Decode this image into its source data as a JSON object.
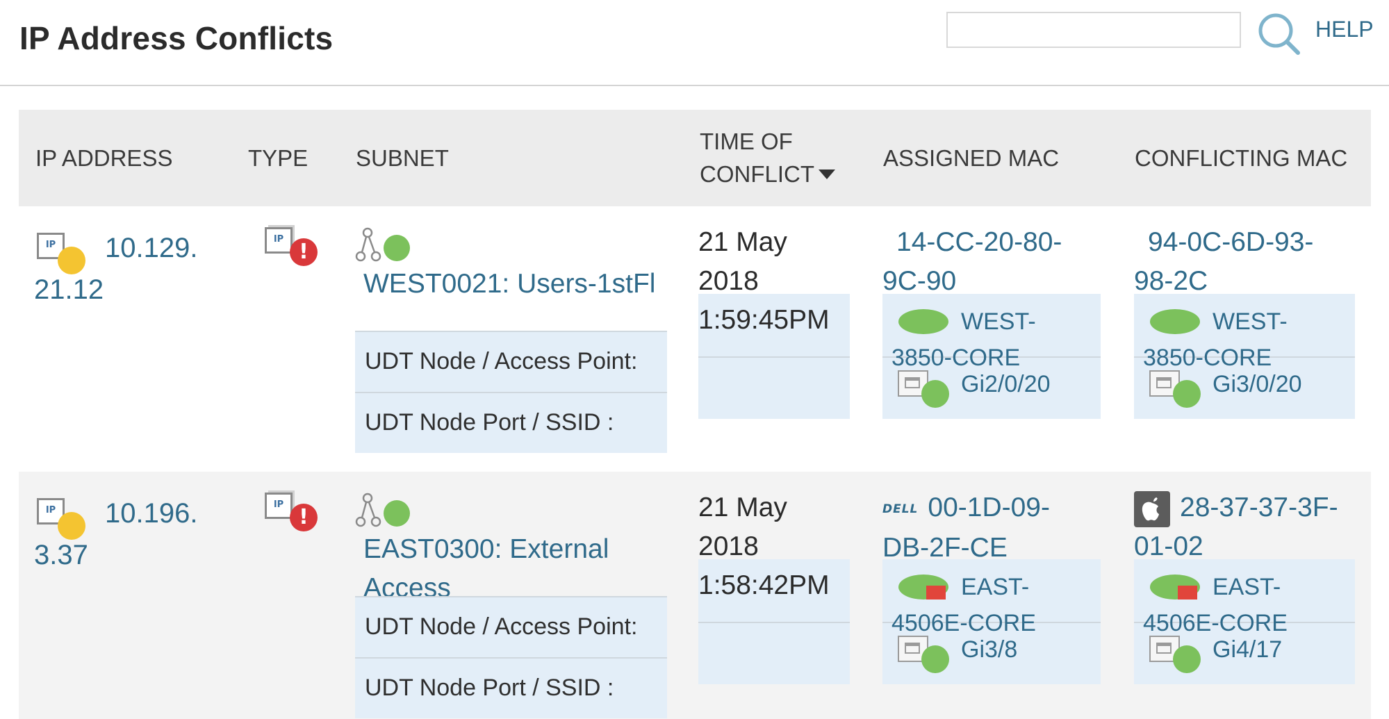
{
  "header": {
    "title": "IP Address Conflicts",
    "search_placeholder": "",
    "help_label": "HELP"
  },
  "table": {
    "columns": [
      "IP ADDRESS",
      "TYPE",
      "SUBNET",
      "TIME OF",
      "CONFLICT",
      "ASSIGNED MAC",
      "CONFLICTING MAC"
    ],
    "rows": [
      {
        "ip_line1": "10.129.",
        "ip_line2": "21.12",
        "subnet": "WEST0021: Users-1stFl",
        "udt_node_label": "UDT Node / Access Point:",
        "udt_port_label": "UDT Node Port / SSID :",
        "time_line1": "21 May",
        "time_line2": "2018",
        "time_line3": "1:59:45PM",
        "assigned_mac_line1": "14-CC-20-80-",
        "assigned_mac_line2": "9C-90",
        "assigned_device_line1": "WEST-",
        "assigned_device_line2": "3850-CORE",
        "assigned_port": "Gi2/0/20",
        "conflicting_mac_line1": "94-0C-6D-93-",
        "conflicting_mac_line2": "98-2C",
        "conflicting_device_line1": "WEST-",
        "conflicting_device_line2": "3850-CORE",
        "conflicting_port": "Gi3/0/20"
      },
      {
        "ip_line1": "10.196.",
        "ip_line2": "3.37",
        "subnet_line1": "EAST0300: External",
        "subnet_line2": "Access",
        "udt_node_label": "UDT Node / Access Point:",
        "udt_port_label": "UDT Node Port / SSID :",
        "time_line1": "21 May",
        "time_line2": "2018",
        "time_line3": "1:58:42PM",
        "assigned_vendor": "DELL",
        "assigned_mac_line1": "00-1D-09-",
        "assigned_mac_line2": "DB-2F-CE",
        "assigned_device_line1": "EAST-",
        "assigned_device_line2": "4506E-CORE",
        "assigned_port": "Gi3/8",
        "conflicting_mac_line1": "28-37-37-3F-",
        "conflicting_mac_line2": "01-02",
        "conflicting_device_line1": "EAST-",
        "conflicting_device_line2": "4506E-CORE",
        "conflicting_port": "Gi4/17"
      }
    ]
  },
  "icons": {
    "ip_badge_text": "IP",
    "error_mark": "!"
  },
  "colors": {
    "link": "#2f6a8a",
    "header_bg": "#ececec",
    "detail_bg": "#e3eef8",
    "status_up": "#7cc15c",
    "status_warning": "#f4c431",
    "status_error": "#d9383a"
  }
}
